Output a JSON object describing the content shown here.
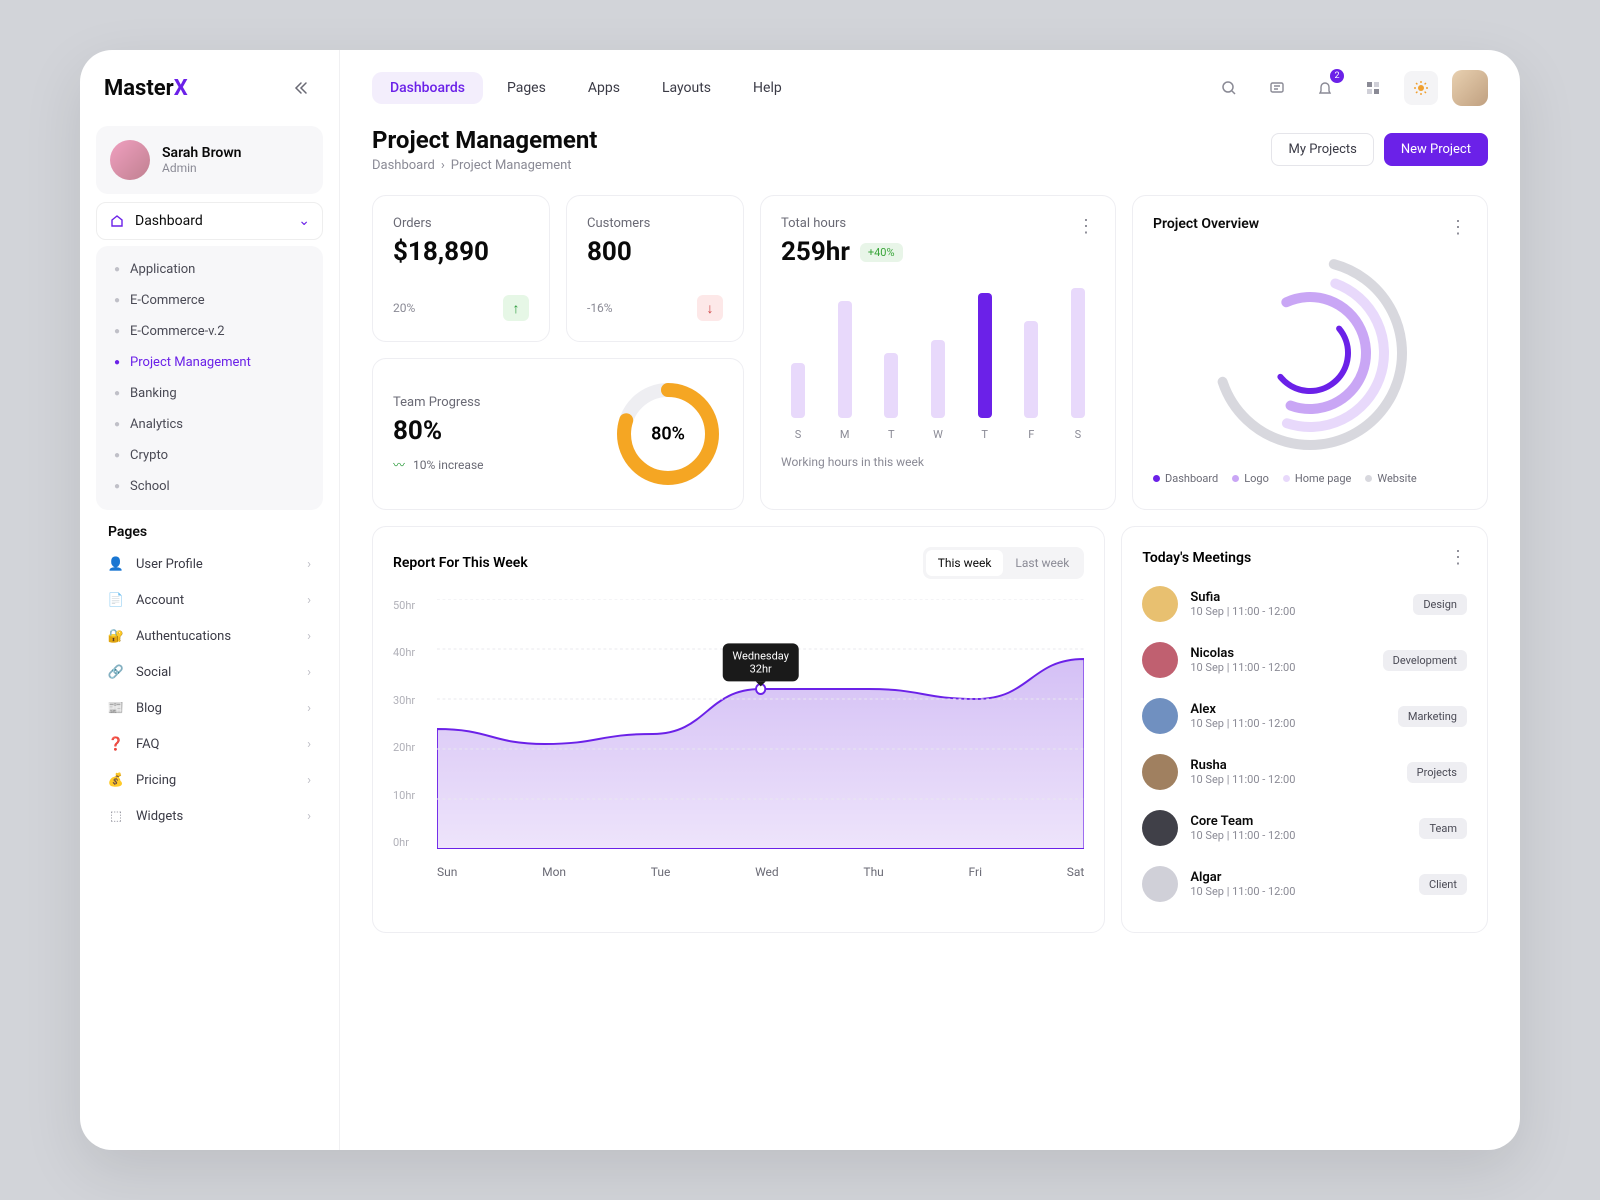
{
  "logo": {
    "text": "Master",
    "accent": "X"
  },
  "user": {
    "name": "Sarah Brown",
    "role": "Admin"
  },
  "nav": {
    "dashboard_label": "Dashboard",
    "sub_items": [
      "Application",
      "E-Commerce",
      "E-Commerce-v.2",
      "Project Management",
      "Banking",
      "Analytics",
      "Crypto",
      "School"
    ],
    "sub_active_index": 3,
    "pages_title": "Pages",
    "pages_items": [
      "User Profile",
      "Account",
      "Authentucations",
      "Social",
      "Blog",
      "FAQ",
      "Pricing",
      "Widgets"
    ]
  },
  "topnav": {
    "tabs": [
      "Dashboards",
      "Pages",
      "Apps",
      "Layouts",
      "Help"
    ],
    "active_index": 0,
    "notif_badge": "2"
  },
  "page_header": {
    "title": "Project Management",
    "crumb1": "Dashboard",
    "crumb2": "Project Management",
    "btn_my_projects": "My Projects",
    "btn_new_project": "New Project"
  },
  "orders_card": {
    "label": "Orders",
    "value": "$18,890",
    "delta": "20%"
  },
  "customers_card": {
    "label": "Customers",
    "value": "800",
    "delta": "-16%"
  },
  "team_card": {
    "label": "Team Progress",
    "value": "80%",
    "donut_pct": "80%",
    "increase": "10% increase"
  },
  "hours_card": {
    "label": "Total hours",
    "value": "259hr",
    "pill": "+40%",
    "subtitle": "Working hours in this week"
  },
  "overview_card": {
    "title": "Project Overview",
    "legend": [
      {
        "name": "Dashboard",
        "color": "#6b21e8"
      },
      {
        "name": "Logo",
        "color": "#c9a6f5"
      },
      {
        "name": "Home page",
        "color": "#e8d9fb"
      },
      {
        "name": "Website",
        "color": "#d8d8de"
      }
    ]
  },
  "report_card": {
    "title": "Report For This Week",
    "toggle": [
      "This week",
      "Last week"
    ],
    "tooltip_day": "Wednesday",
    "tooltip_val": "32hr"
  },
  "meetings_card": {
    "title": "Today's Meetings",
    "items": [
      {
        "name": "Sufia",
        "time": "10 Sep | 11:00 - 12:00",
        "tag": "Design",
        "av": "#e8c070"
      },
      {
        "name": "Nicolas",
        "time": "10 Sep | 11:00 - 12:00",
        "tag": "Development",
        "av": "#c06070"
      },
      {
        "name": "Alex",
        "time": "10 Sep | 11:00 - 12:00",
        "tag": "Marketing",
        "av": "#7090c0"
      },
      {
        "name": "Rusha",
        "time": "10 Sep | 11:00 - 12:00",
        "tag": "Projects",
        "av": "#a08060"
      },
      {
        "name": "Core Team",
        "time": "10 Sep | 11:00 - 12:00",
        "tag": "Team",
        "av": "#404048"
      },
      {
        "name": "Algar",
        "time": "10 Sep | 11:00 - 12:00",
        "tag": "Client",
        "av": "#d0d0d8"
      }
    ]
  },
  "chart_data": [
    {
      "type": "bar",
      "title": "Working hours in this week",
      "categories": [
        "S",
        "M",
        "T",
        "W",
        "T",
        "F",
        "S"
      ],
      "values": [
        42,
        90,
        50,
        60,
        96,
        75,
        100
      ],
      "colors": [
        "#e8d9fb",
        "#e8d9fb",
        "#e8d9fb",
        "#e8d9fb",
        "#6b21e8",
        "#e8d9fb",
        "#e8d9fb"
      ]
    },
    {
      "type": "area",
      "title": "Report For This Week",
      "xlabel": "",
      "ylabel": "hr",
      "x": [
        "Sun",
        "Mon",
        "Tue",
        "Wed",
        "Thu",
        "Fri",
        "Sat"
      ],
      "y_ticks": [
        "50hr",
        "40hr",
        "30hr",
        "20hr",
        "10hr",
        "0hr"
      ],
      "values": [
        24,
        21,
        23,
        32,
        32,
        30,
        38
      ],
      "ylim": [
        0,
        50
      ],
      "tooltip": {
        "x": "Wednesday",
        "y": "32hr"
      }
    }
  ]
}
